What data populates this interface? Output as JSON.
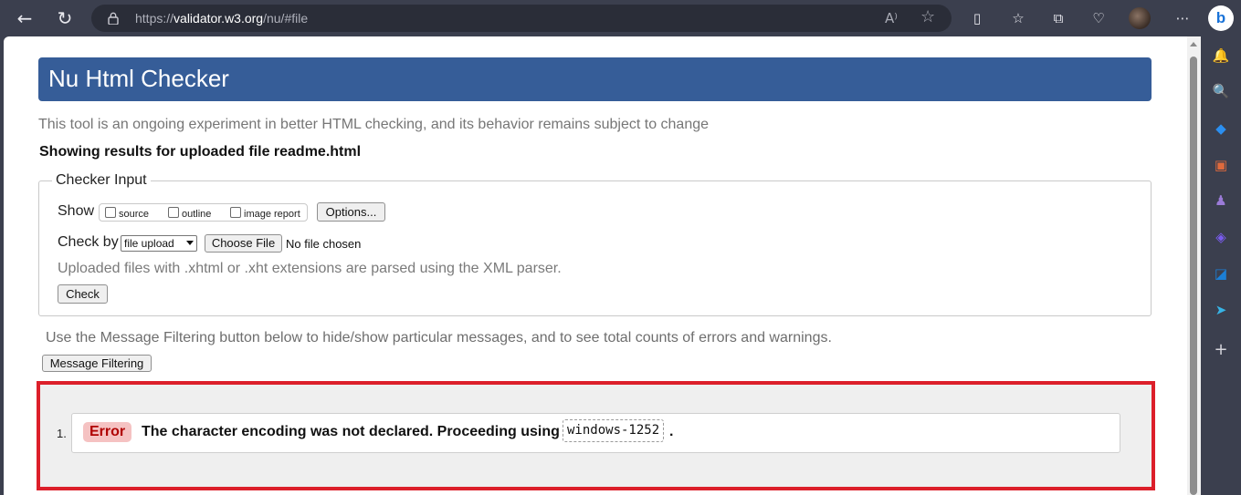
{
  "browser": {
    "url_prefix": "https://",
    "url_host": "validator.w3.org",
    "url_path": "/nu/#file",
    "back_icon": "←",
    "refresh_icon": "↻",
    "read_aloud_icon": "A⁾",
    "favorite_icon": "☆",
    "split_icon": "▯",
    "favorites_icon": "☆",
    "collections_icon": "⧉",
    "performance_icon": "♡",
    "menu_icon": "⋯",
    "bing_label": "b"
  },
  "sidebar": {
    "icons": [
      {
        "name": "bell-icon",
        "glyph": "🔔",
        "color": "#5aa7f5"
      },
      {
        "name": "search-icon",
        "glyph": "🔍",
        "color": "#8fd0ff"
      },
      {
        "name": "tag-icon",
        "glyph": "◆",
        "color": "#2b8ff0"
      },
      {
        "name": "toolbox-icon",
        "glyph": "▣",
        "color": "#e06a3c"
      },
      {
        "name": "games-icon",
        "glyph": "♟",
        "color": "#9b7bd8"
      },
      {
        "name": "copilot-icon",
        "glyph": "◈",
        "color": "#7a5cf0"
      },
      {
        "name": "outlook-icon",
        "glyph": "◪",
        "color": "#1c7fd6"
      },
      {
        "name": "send-icon",
        "glyph": "➤",
        "color": "#37b4e6"
      },
      {
        "name": "add-icon",
        "glyph": "+",
        "color": "#d6d6dc"
      }
    ]
  },
  "page": {
    "title": "Nu Html Checker",
    "note": "This tool is an ongoing experiment in better HTML checking, and its behavior remains subject to change",
    "results_heading": "Showing results for uploaded file readme.html",
    "checker_input": {
      "legend": "Checker Input",
      "show_label": "Show",
      "options": [
        {
          "label": "source",
          "checked": false
        },
        {
          "label": "outline",
          "checked": false
        },
        {
          "label": "image report",
          "checked": false
        }
      ],
      "options_button": "Options...",
      "check_by_label": "Check by",
      "check_by_selected": "file upload",
      "choose_file_button": "Choose File",
      "no_file_text": "No file chosen",
      "xml_note": "Uploaded files with .xhtml or .xht extensions are parsed using the XML parser.",
      "check_button": "Check"
    },
    "filter_note": "Use the Message Filtering button below to hide/show particular messages, and to see total counts of errors and warnings.",
    "filter_button": "Message Filtering",
    "messages": [
      {
        "number": "1.",
        "type": "Error",
        "text": "The character encoding was not declared. Proceeding using",
        "code": "windows-1252",
        "suffix": "."
      }
    ]
  },
  "colors": {
    "title_bar": "#365d98",
    "highlight_border": "#dc1f2a",
    "error_badge_bg": "#f5c2c2",
    "error_badge_text": "#b00000"
  }
}
